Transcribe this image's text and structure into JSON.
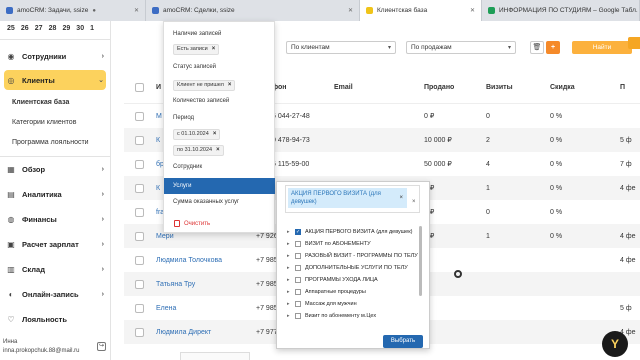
{
  "browser_tabs": [
    {
      "label": "amoCRM: Задачи, ssize",
      "color": "#3d6dc4"
    },
    {
      "label": "amoCRM: Сделки, ssize",
      "color": "#3d6dc4"
    },
    {
      "label": "Клиентская база",
      "color": "#f0c419"
    },
    {
      "label": "ИНФОРМАЦИЯ ПО СТУДИЯМ – Google Табл.",
      "color": "#1e9e57"
    }
  ],
  "sidebar": {
    "dates": [
      "25",
      "26",
      "27",
      "28",
      "29",
      "30",
      "1"
    ],
    "items": [
      {
        "label": "Сотрудники",
        "icon": "users-icon"
      },
      {
        "label": "Клиенты",
        "icon": "clients-icon"
      },
      {
        "label": "Обзор",
        "icon": "chart-icon"
      },
      {
        "label": "Аналитика",
        "icon": "analytics-icon"
      },
      {
        "label": "Финансы",
        "icon": "finance-icon"
      },
      {
        "label": "Расчет зарплат",
        "icon": "salary-icon"
      },
      {
        "label": "Склад",
        "icon": "warehouse-icon"
      },
      {
        "label": "Онлайн-запись",
        "icon": "online-icon"
      },
      {
        "label": "Лояльность",
        "icon": "loyalty-icon"
      }
    ],
    "subitems": [
      "Клиентская база",
      "Категории клиентов",
      "Программа лояльности"
    ],
    "user_name": "Инна",
    "user_email": "inna.prokopchuk.88@mail.ru"
  },
  "toolbar": {
    "by_clients": "По клиентам",
    "by_sales": "По продажам",
    "find_label": "Найти"
  },
  "table": {
    "headers": [
      "И",
      "фон",
      "Email",
      "Продано",
      "Визиты",
      "Скидка",
      "П"
    ],
    "rows": [
      {
        "name": "М",
        "phone": "5 044-27-48",
        "sold": "0 ₽",
        "visits": "0",
        "discount": "0 %",
        "last": ""
      },
      {
        "name": "К",
        "phone": "0 478-94-73",
        "sold": "10 000 ₽",
        "visits": "2",
        "discount": "0 %",
        "last": "5 ф"
      },
      {
        "name": "бр",
        "phone": "5 115-59-00",
        "sold": "50 000 ₽",
        "visits": "4",
        "discount": "0 %",
        "last": "7 ф"
      },
      {
        "name": "К",
        "phone": "",
        "sold": "0 ₽",
        "visits": "1",
        "discount": "0 %",
        "last": "4 фе"
      },
      {
        "name": "fra",
        "phone": "",
        "sold": "0 ₽",
        "visits": "0",
        "discount": "0 %",
        "last": ""
      },
      {
        "name": "Мери",
        "phone": "+7 926",
        "sold": "0 ₽",
        "visits": "1",
        "discount": "0 %",
        "last": "4 фе"
      },
      {
        "name": "Людмила Толочкова",
        "phone": "+7 985",
        "sold": "",
        "visits": "",
        "discount": "",
        "last": "4 фе"
      },
      {
        "name": "Татьяна Тру",
        "phone": "+7 985",
        "sold": "",
        "visits": "",
        "discount": "",
        "last": ""
      },
      {
        "name": "Елена",
        "phone": "+7 985",
        "sold": "",
        "visits": "",
        "discount": "",
        "last": "5 ф"
      },
      {
        "name": "Людмила Директ",
        "phone": "+7 977",
        "sold": "",
        "visits": "",
        "discount": "",
        "last": "4 фе"
      }
    ]
  },
  "filter_panel": {
    "records_label": "Наличие записей",
    "records_chip": "Есть записи",
    "status_label": "Статус записей",
    "status_chip": "Клиент не пришел",
    "count_label": "Количество записей",
    "period_label": "Период",
    "period_from": "с 01.10.2024",
    "period_to": "по 31.10.2024",
    "employee_label": "Сотрудник",
    "services_label": "Услуги",
    "sum_label": "Сумма оказанных услуг",
    "clear_label": "Очистить"
  },
  "services_dropdown": {
    "selected_tag": "АКЦИЯ ПЕРВОГО ВИЗИТА (для девушек)",
    "items": [
      {
        "label": "АКЦИЯ ПЕРВОГО ВИЗИТА (для девушек)",
        "checked": true,
        "expandable": true
      },
      {
        "label": "ВИЗИТ по АБОНЕМЕНТУ",
        "checked": false,
        "expandable": true
      },
      {
        "label": "РАЗОВЫЙ ВИЗИТ - ПРОГРАММЫ ПО ТЕЛУ",
        "checked": false,
        "expandable": true
      },
      {
        "label": "ДОПОЛНИТЕЛЬНЫЕ УСЛУГИ ПО ТЕЛУ",
        "checked": false,
        "expandable": true
      },
      {
        "label": "ПРОГРАММЫ УХОДА ЛИЦА",
        "checked": false,
        "expandable": true
      },
      {
        "label": "Аппаратные процедуры",
        "checked": false,
        "expandable": true
      },
      {
        "label": "Массаж для мужчин",
        "checked": false,
        "expandable": true
      },
      {
        "label": "Визит по абонементу м.Цех",
        "checked": false,
        "expandable": true
      }
    ],
    "choose_label": "Выбрать"
  },
  "accent_colors": {
    "yellow": "#fcd25d",
    "blue": "#2468b0",
    "orange": "#f58a2a"
  }
}
